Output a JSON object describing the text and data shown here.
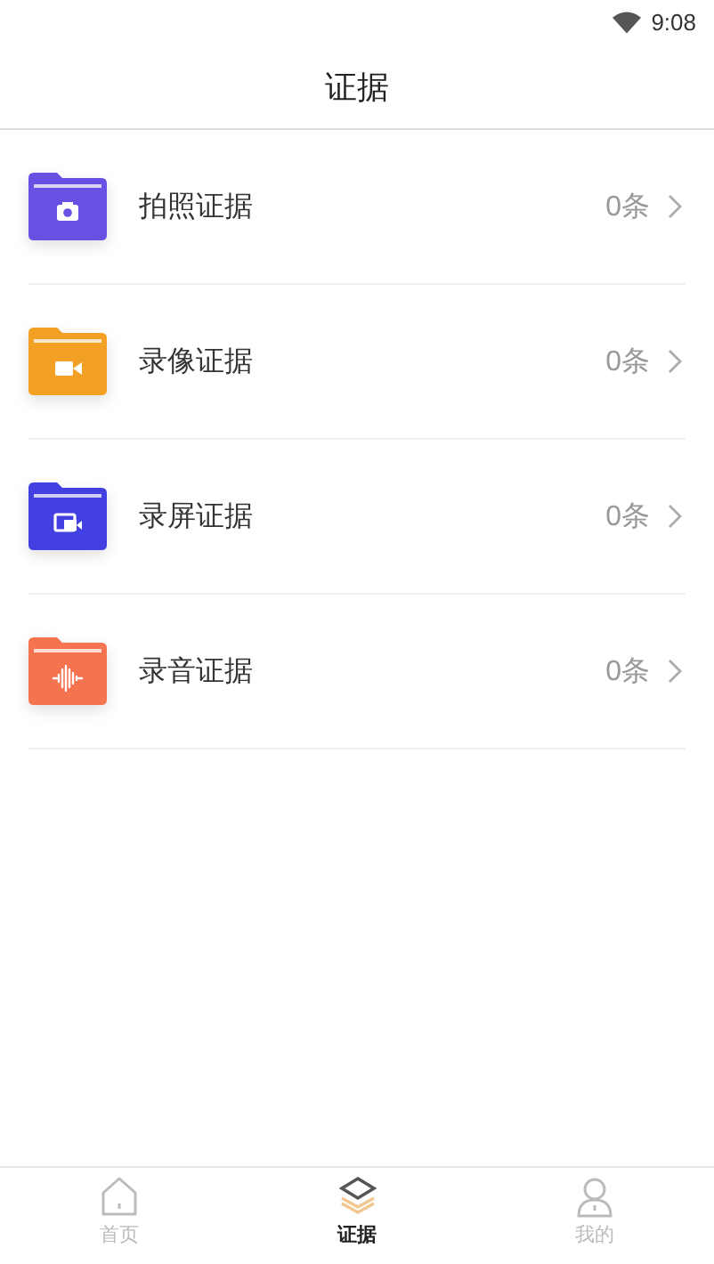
{
  "status_bar": {
    "time": "9:08"
  },
  "header": {
    "title": "证据"
  },
  "folders": [
    {
      "label": "拍照证据",
      "count": "0条",
      "color": "#6a4fe4",
      "kind": "camera"
    },
    {
      "label": "录像证据",
      "count": "0条",
      "color": "#f2a024",
      "kind": "video"
    },
    {
      "label": "录屏证据",
      "count": "0条",
      "color": "#4340e2",
      "kind": "screen"
    },
    {
      "label": "录音证据",
      "count": "0条",
      "color": "#f5734f",
      "kind": "audio"
    }
  ],
  "tabs": [
    {
      "label": "首页",
      "kind": "home",
      "selected": false
    },
    {
      "label": "证据",
      "kind": "layers",
      "selected": true
    },
    {
      "label": "我的",
      "kind": "person",
      "selected": false
    }
  ]
}
